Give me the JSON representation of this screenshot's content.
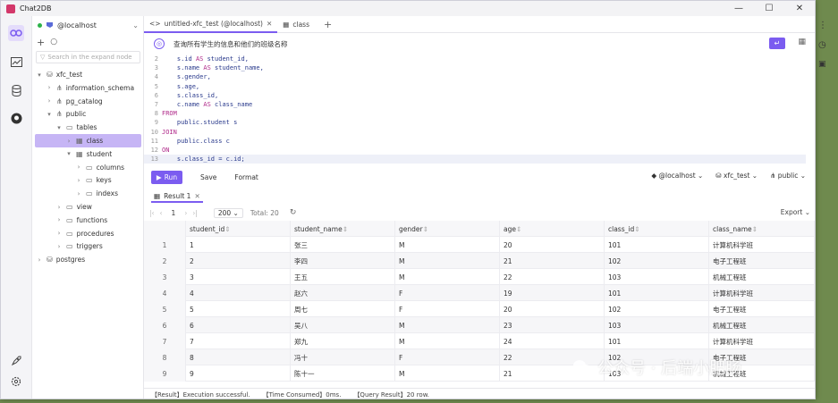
{
  "window": {
    "title": "Chat2DB"
  },
  "sidebar": {
    "connection": "@localhost",
    "search_placeholder": "Search in the expand node",
    "tree": [
      {
        "label": "xfc_test",
        "icon": "database-icon",
        "chev": "▾",
        "indent": 0
      },
      {
        "label": "information_schema",
        "icon": "schema-icon",
        "chev": "›",
        "indent": 1
      },
      {
        "label": "pg_catalog",
        "icon": "schema-icon",
        "chev": "›",
        "indent": 1
      },
      {
        "label": "public",
        "icon": "schema-icon",
        "chev": "▾",
        "indent": 1
      },
      {
        "label": "tables",
        "icon": "folder-icon",
        "chev": "▾",
        "indent": 2
      },
      {
        "label": "class",
        "icon": "table-icon",
        "chev": "›",
        "indent": 3,
        "selected": true
      },
      {
        "label": "student",
        "icon": "table-icon",
        "chev": "▾",
        "indent": 3
      },
      {
        "label": "columns",
        "icon": "folder-icon",
        "chev": "›",
        "indent": 4
      },
      {
        "label": "keys",
        "icon": "folder-icon",
        "chev": "›",
        "indent": 4
      },
      {
        "label": "indexs",
        "icon": "folder-icon",
        "chev": "›",
        "indent": 4
      },
      {
        "label": "view",
        "icon": "folder-icon",
        "chev": "›",
        "indent": 2
      },
      {
        "label": "functions",
        "icon": "folder-icon",
        "chev": "›",
        "indent": 2
      },
      {
        "label": "procedures",
        "icon": "folder-icon",
        "chev": "›",
        "indent": 2
      },
      {
        "label": "triggers",
        "icon": "folder-icon",
        "chev": "›",
        "indent": 2
      },
      {
        "label": "postgres",
        "icon": "database-icon",
        "chev": "›",
        "indent": 0
      }
    ]
  },
  "tabs": [
    {
      "label": "untitled-xfc_test (@localhost)",
      "icon": "code-icon",
      "active": true,
      "closable": true
    },
    {
      "label": "class",
      "icon": "table-icon",
      "active": false,
      "closable": false
    }
  ],
  "nl_query": "查询所有学生的信息和他们的班级名称",
  "editor": {
    "lines": [
      {
        "n": "2",
        "text": "    s.id AS student_id,"
      },
      {
        "n": "3",
        "text": "    s.name AS student_name,"
      },
      {
        "n": "4",
        "text": "    s.gender,"
      },
      {
        "n": "5",
        "text": "    s.age,"
      },
      {
        "n": "6",
        "text": "    s.class_id,"
      },
      {
        "n": "7",
        "text": "    c.name AS class_name"
      },
      {
        "n": "8",
        "text": "FROM"
      },
      {
        "n": "9",
        "text": "    public.student s"
      },
      {
        "n": "10",
        "text": "JOIN"
      },
      {
        "n": "11",
        "text": "    public.class c"
      },
      {
        "n": "12",
        "text": "ON"
      },
      {
        "n": "13",
        "text": "    s.class_id = c.id;"
      }
    ]
  },
  "runbar": {
    "run_label": "Run",
    "save_label": "Save",
    "format_label": "Format",
    "connection": "@localhost",
    "database": "xfc_test",
    "schema": "public"
  },
  "result": {
    "tab_label": "Result 1",
    "page": "1",
    "page_size": "200",
    "total": "Total: 20",
    "export_label": "Export",
    "columns": [
      "student_id",
      "student_name",
      "gender",
      "age",
      "class_id",
      "class_name"
    ],
    "rows": [
      [
        "1",
        "1",
        "张三",
        "M",
        "20",
        "101",
        "计算机科学班"
      ],
      [
        "2",
        "2",
        "李四",
        "M",
        "21",
        "102",
        "电子工程班"
      ],
      [
        "3",
        "3",
        "王五",
        "M",
        "22",
        "103",
        "机械工程班"
      ],
      [
        "4",
        "4",
        "赵六",
        "F",
        "19",
        "101",
        "计算机科学班"
      ],
      [
        "5",
        "5",
        "周七",
        "F",
        "20",
        "102",
        "电子工程班"
      ],
      [
        "6",
        "6",
        "吴八",
        "M",
        "23",
        "103",
        "机械工程班"
      ],
      [
        "7",
        "7",
        "郑九",
        "M",
        "24",
        "101",
        "计算机科学班"
      ],
      [
        "8",
        "8",
        "冯十",
        "F",
        "22",
        "102",
        "电子工程班"
      ],
      [
        "9",
        "9",
        "陈十一",
        "M",
        "21",
        "103",
        "机械工程班"
      ]
    ]
  },
  "status": {
    "result": "【Result】Execution successful.",
    "time": "【Time Consumed】0ms.",
    "query": "【Query Result】20 row."
  },
  "watermark": "公众号 · 后端小肥肠"
}
